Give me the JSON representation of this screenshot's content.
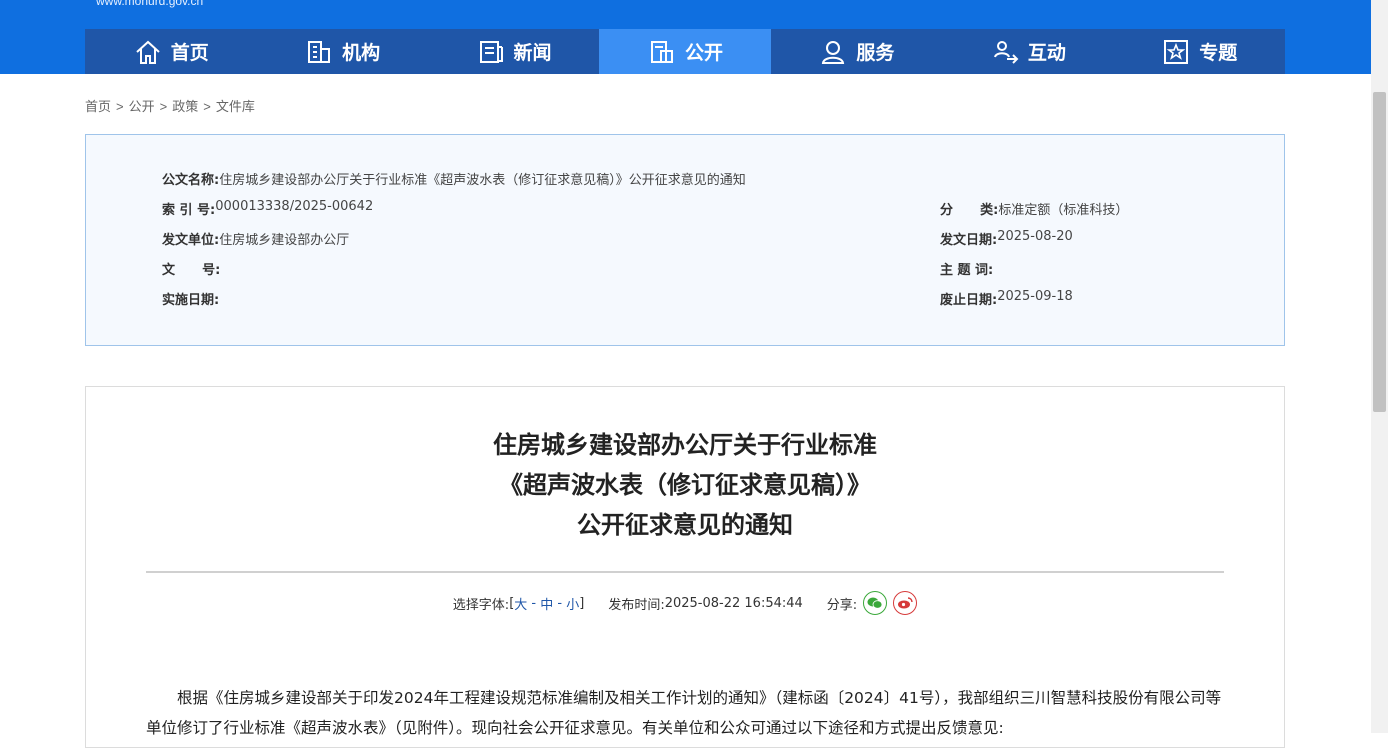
{
  "header": {
    "site_url": "www.mohurd.gov.cn",
    "nav": [
      {
        "label": "首页",
        "icon": "home-icon"
      },
      {
        "label": "机构",
        "icon": "building-icon"
      },
      {
        "label": "新闻",
        "icon": "news-icon"
      },
      {
        "label": "公开",
        "icon": "disclosure-icon",
        "active": true
      },
      {
        "label": "服务",
        "icon": "service-icon"
      },
      {
        "label": "互动",
        "icon": "interaction-icon"
      },
      {
        "label": "专题",
        "icon": "topic-icon"
      }
    ]
  },
  "breadcrumb": [
    "首页",
    "公开",
    "政策",
    "文件库"
  ],
  "meta": {
    "doc_name_label": "公文名称:",
    "doc_name": "住房城乡建设部办公厅关于行业标准《超声波水表（修订征求意见稿）》公开征求意见的通知",
    "index_label": "索 引 号:",
    "index": "000013338/2025-00642",
    "category_label": "分      类:",
    "category": "标准定额（标准科技）",
    "issuer_label": "发文单位:",
    "issuer": "住房城乡建设部办公厅",
    "issue_date_label": "发文日期:",
    "issue_date": "2025-08-20",
    "doc_no_label": "文      号:",
    "doc_no": "",
    "subject_label": "主 题 词:",
    "subject": "",
    "effective_label": "实施日期:",
    "effective": "",
    "expiry_label": "废止日期:",
    "expiry": "2025-09-18"
  },
  "article": {
    "title_lines": [
      "住房城乡建设部办公厅关于行业标准",
      "《超声波水表（修订征求意见稿）》",
      "公开征求意见的通知"
    ],
    "font_label": "选择字体:",
    "font_open": "[",
    "font_large": "大",
    "font_sep1": " - ",
    "font_medium": "中",
    "font_sep2": " - ",
    "font_small": "小",
    "font_close": "]",
    "publish_label": "发布时间:",
    "publish_time": "2025-08-22 16:54:44",
    "share_label": "分享:",
    "body": "根据《住房城乡建设部关于印发2024年工程建设规范标准编制及相关工作计划的通知》（建标函〔2024〕41号），我部组织三川智慧科技股份有限公司等单位修订了行业标准《超声波水表》（见附件）。现向社会公开征求意见。有关单位和公众可通过以下途径和方式提出反馈意见:"
  },
  "colors": {
    "header_blue": "#0f6fe0",
    "nav_dark": "#1f56a8",
    "nav_active": "#3b8ff3",
    "meta_border": "#9fc4ea"
  }
}
